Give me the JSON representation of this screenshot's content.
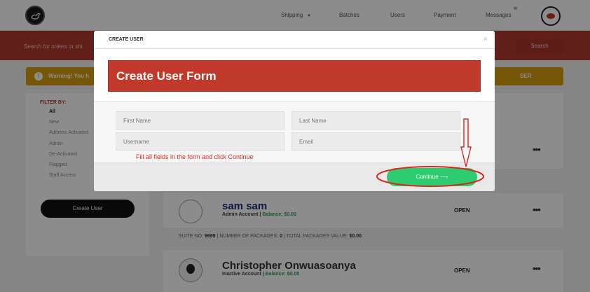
{
  "nav": {
    "items": [
      {
        "label": "Shipping",
        "has_caret": true
      },
      {
        "label": "Batches"
      },
      {
        "label": "Users"
      },
      {
        "label": "Payment"
      },
      {
        "label": "Messages"
      }
    ]
  },
  "search": {
    "label": "Search for orders or shi",
    "button": "Search"
  },
  "warning": {
    "text": "Warning! You h",
    "right_text": "SER"
  },
  "sidebar": {
    "filter_heading": "FILTER BY:",
    "filters": [
      "All",
      "New",
      "Address Activated",
      "Admin",
      "De-Activated",
      "Flagged",
      "Staff Access"
    ],
    "create_button": "Create User"
  },
  "users": [
    {
      "name": "sam sam",
      "role": "Admin Account",
      "separator": " | ",
      "balance": "Balance: $0.00",
      "status": "OPEN"
    },
    {
      "name": "Christopher Onwuasoanya",
      "role": "Inactive Account",
      "separator": " | ",
      "balance": "Balance: $0.00",
      "status": "OPEN"
    }
  ],
  "meta_row": {
    "suite_label": "SUITE NO:",
    "suite": "9699",
    "packages_label": "| NUMBER OF PACKAGES:",
    "packages": "0",
    "value_label": "| TOTAL PACKAGES VALUE:",
    "value": "$0.00"
  },
  "modal": {
    "title": "CREATE USER",
    "close": "×",
    "banner": "Create User Form",
    "fields": {
      "first_name": "First Name",
      "last_name": "Last Name",
      "username": "Username",
      "email": "Email"
    },
    "hint": "Fill all fields in the form and click Continue",
    "continue": "Continue"
  },
  "icons": {
    "more": "more-dots-icon",
    "arrow": "arrow-right-icon",
    "warning": "warning-icon"
  },
  "colors": {
    "brand_red": "#b23a30",
    "banner_red": "#c0392b",
    "warning": "#d89e12",
    "success": "#2ecc71",
    "annotation": "#d9281c"
  }
}
